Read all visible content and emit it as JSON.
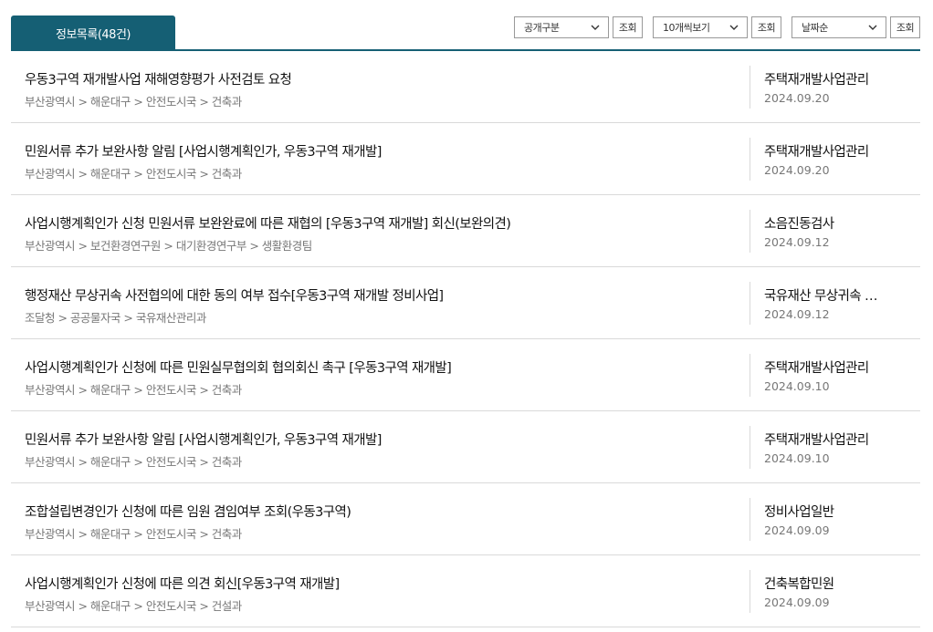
{
  "tab": {
    "label": "정보목록(48건)"
  },
  "controls": {
    "open_type": {
      "selected": "공개구분"
    },
    "page_size": {
      "selected": "10개씩보기"
    },
    "sort": {
      "selected": "날짜순"
    },
    "search_label": "조회"
  },
  "items": [
    {
      "title": "우동3구역 재개발사업 재해영향평가 사전검토 요청",
      "path": "부산광역시 > 해운대구 > 안전도시국 > 건축과",
      "category": "주택재개발사업관리",
      "date": "2024.09.20"
    },
    {
      "title": "민원서류 추가 보완사항 알림 [사업시행계획인가, 우동3구역 재개발]",
      "path": "부산광역시 > 해운대구 > 안전도시국 > 건축과",
      "category": "주택재개발사업관리",
      "date": "2024.09.20"
    },
    {
      "title": "사업시행계획인가 신청 민원서류 보완완료에 따른 재협의 [우동3구역 재개발] 회신(보완의견)",
      "path": "부산광역시 > 보건환경연구원 > 대기환경연구부 > 생활환경팀",
      "category": "소음진동검사",
      "date": "2024.09.12"
    },
    {
      "title": "행정재산 무상귀속 사전협의에 대한 동의 여부 접수[우동3구역 재개발 정비사업]",
      "path": "조달청 > 공공물자국 > 국유재산관리과",
      "category": "국유재산 무상귀속 …",
      "date": "2024.09.12"
    },
    {
      "title": "사업시행계획인가 신청에 따른 민원실무협의회 협의회신 촉구 [우동3구역 재개발]",
      "path": "부산광역시 > 해운대구 > 안전도시국 > 건축과",
      "category": "주택재개발사업관리",
      "date": "2024.09.10"
    },
    {
      "title": "민원서류 추가 보완사항 알림 [사업시행계획인가, 우동3구역 재개발]",
      "path": "부산광역시 > 해운대구 > 안전도시국 > 건축과",
      "category": "주택재개발사업관리",
      "date": "2024.09.10"
    },
    {
      "title": "조합설립변경인가 신청에 따른 임원 겸임여부 조회(우동3구역)",
      "path": "부산광역시 > 해운대구 > 안전도시국 > 건축과",
      "category": "정비사업일반",
      "date": "2024.09.09"
    },
    {
      "title": "사업시행계획인가 신청에 따른 의견 회신[우동3구역 재개발]",
      "path": "부산광역시 > 해운대구 > 안전도시국 > 건설과",
      "category": "건축복합민원",
      "date": "2024.09.09"
    }
  ],
  "icons": {
    "select_arrow": "chevron-down-icon"
  },
  "colors": {
    "accent": "#155f74",
    "divider": "#d9d9d9"
  }
}
